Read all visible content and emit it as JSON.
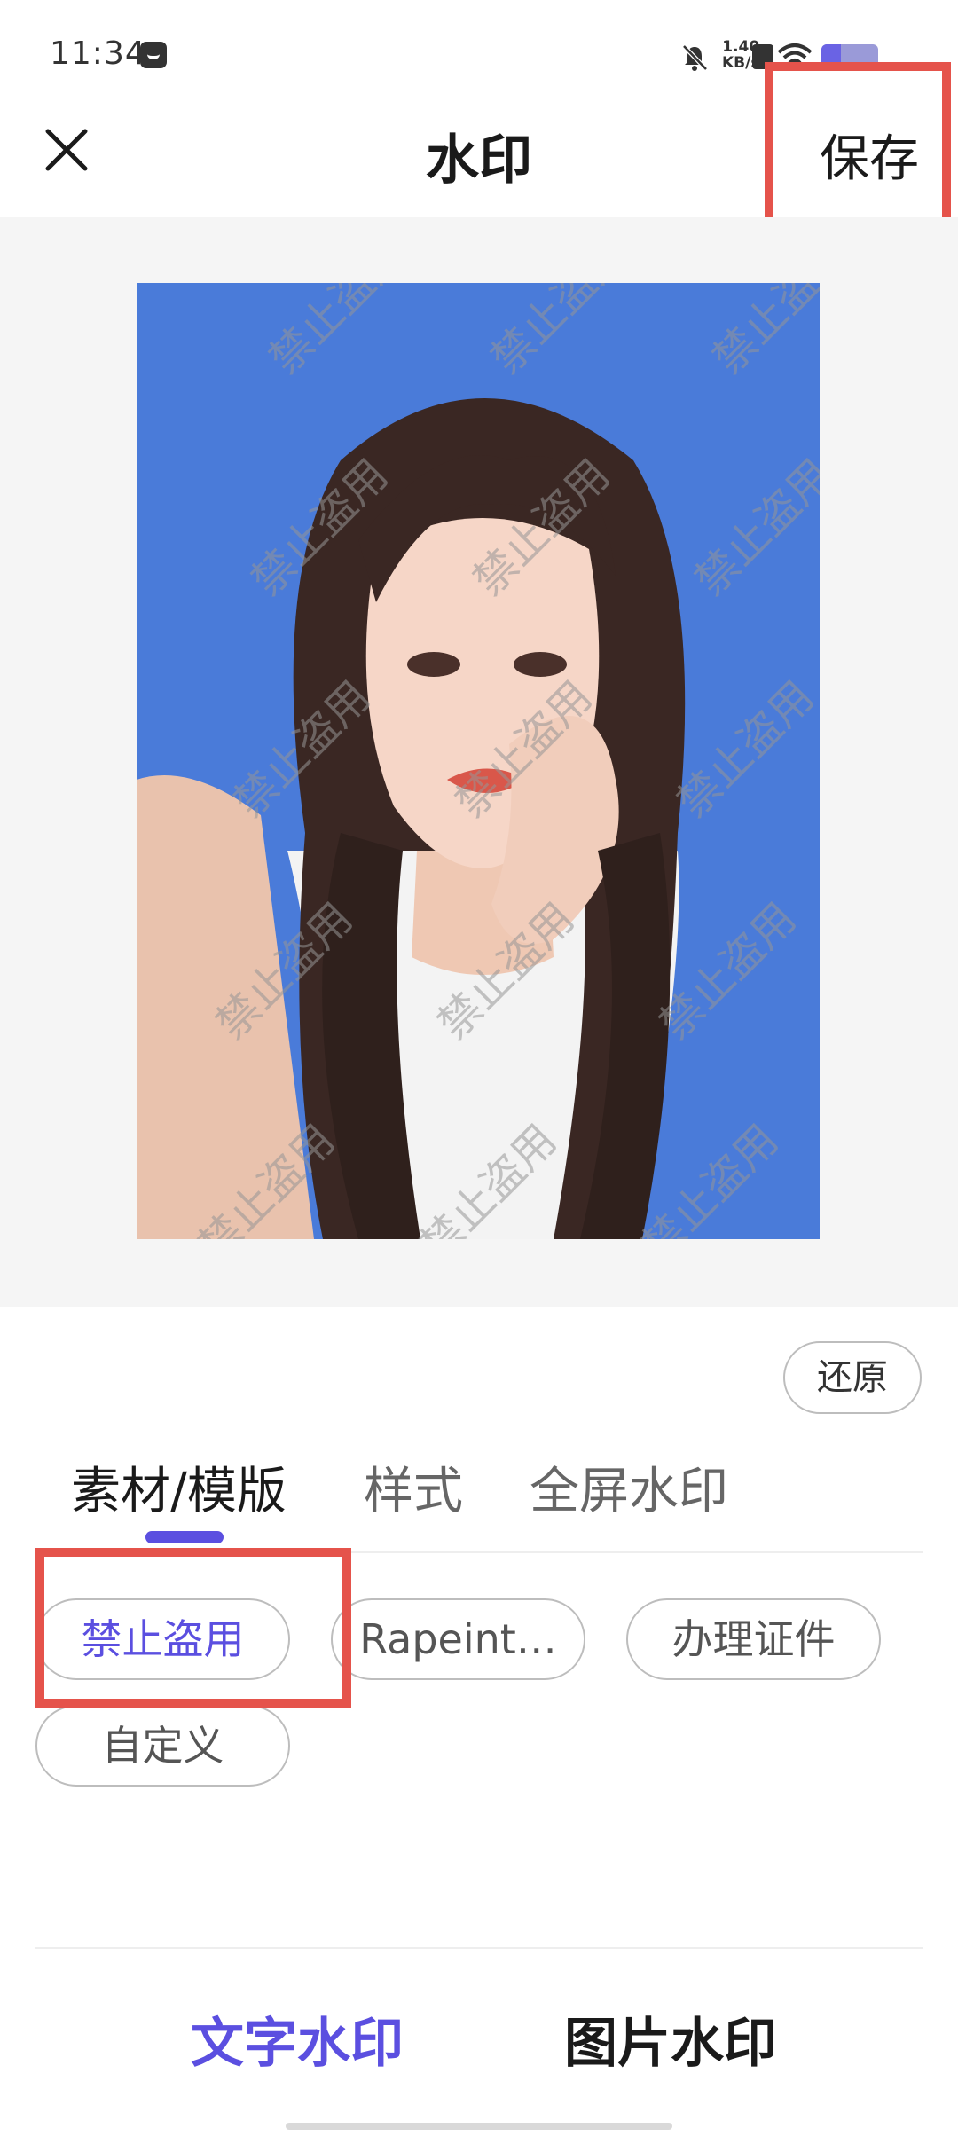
{
  "status_bar": {
    "time": "11:34",
    "net_speed_value": "1.40",
    "net_speed_unit": "KB/s",
    "battery_level": 0.35
  },
  "header": {
    "title": "水印",
    "save_label": "保存"
  },
  "preview": {
    "watermark_text": "禁止盗用",
    "photo_background_color": "#4a7bd9"
  },
  "controls": {
    "restore_label": "还原",
    "tabs": [
      {
        "label": "素材/模版",
        "active": true
      },
      {
        "label": "样式",
        "active": false
      },
      {
        "label": "全屏水印",
        "active": false
      }
    ],
    "chips": [
      {
        "label": "禁止盗用",
        "selected": true
      },
      {
        "label": "Rapeint…",
        "selected": false
      },
      {
        "label": "办理证件",
        "selected": false
      },
      {
        "label": "自定义",
        "selected": false
      }
    ]
  },
  "bottom_tabs": [
    {
      "label": "文字水印",
      "active": true
    },
    {
      "label": "图片水印",
      "active": false
    }
  ],
  "colors": {
    "accent": "#5b4fe0",
    "annotation_red": "#e5534b"
  }
}
